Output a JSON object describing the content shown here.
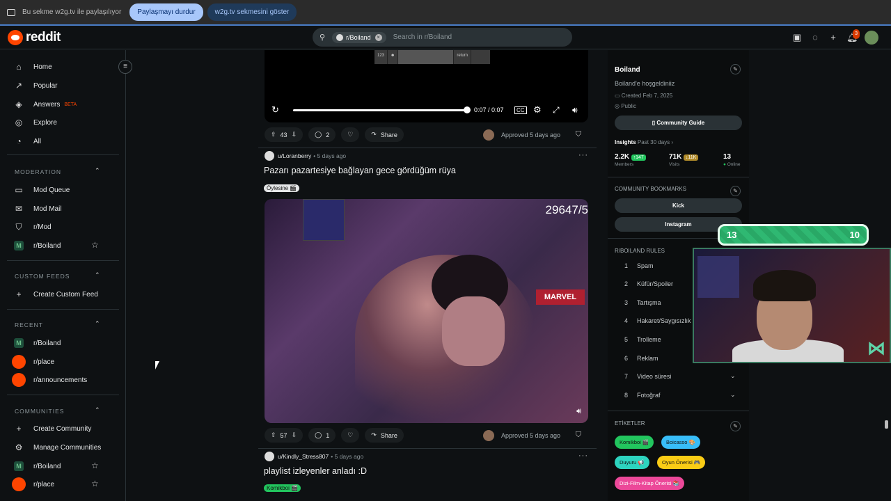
{
  "sharebar": {
    "text": "Bu sekme w2g.tv ile paylaşılıyor",
    "stop_label": "Paylaşmayı durdur",
    "show_label": "w2g.tv sekmesini göster"
  },
  "header": {
    "logo": "reddit",
    "search_chip": "r/Boiland",
    "search_placeholder": "Search in r/Boiland",
    "notif_count": "3"
  },
  "sidebar": {
    "nav": [
      {
        "label": "Home"
      },
      {
        "label": "Popular"
      },
      {
        "label": "Answers",
        "badge": "BETA"
      },
      {
        "label": "Explore"
      },
      {
        "label": "All"
      }
    ],
    "moderation": {
      "title": "MODERATION",
      "items": [
        "Mod Queue",
        "Mod Mail",
        "r/Mod",
        "r/Boiland"
      ]
    },
    "custom_feeds": {
      "title": "CUSTOM FEEDS",
      "items": [
        "Create Custom Feed"
      ]
    },
    "recent": {
      "title": "RECENT",
      "items": [
        "r/Boiland",
        "r/place",
        "r/announcements"
      ]
    },
    "communities": {
      "title": "COMMUNITIES",
      "items": [
        "Create Community",
        "Manage Communities",
        "r/Boiland",
        "r/place"
      ]
    }
  },
  "feed": {
    "video1": {
      "keys": [
        "123",
        "",
        "return"
      ],
      "time": "0:07 / 0:07",
      "progress": 1.0
    },
    "post1_actions": {
      "votes": "43",
      "comments": "2",
      "share": "Share",
      "approved": "Approved 5 days ago"
    },
    "post2": {
      "user": "u/Loranberry",
      "time": "• 5 days ago",
      "title": "Pazarı pazartesiye bağlayan gece gördüğüm rüya",
      "flair": "Öylesine 🎬",
      "score_overlay": "29647/5",
      "actions": {
        "votes": "57",
        "comments": "1",
        "share": "Share",
        "approved": "Approved 5 days ago"
      }
    },
    "post3": {
      "user": "u/Kindly_Stress807",
      "time": "• 5 days ago",
      "title": "playlist izleyenler anladı :D",
      "flair": "Komikboi 🎬"
    }
  },
  "right": {
    "name": "Boiland",
    "description": "Boiland'e hoşgeldiniiz",
    "created": "Created Feb 7, 2025",
    "visibility": "Public",
    "guide_btn": "Community Guide",
    "insights_label": "Insights",
    "insights_period": "Past 30 days",
    "stats": [
      {
        "value": "2.2K",
        "delta": "↑147",
        "label": "Members"
      },
      {
        "value": "71K",
        "delta": "↓11K",
        "label": "Visits"
      },
      {
        "value": "13",
        "label": "Online"
      }
    ],
    "bookmarks_title": "COMMUNITY BOOKMARKS",
    "bookmarks": [
      "Kick",
      "Instagram"
    ],
    "rules_title": "R/BOILAND RULES",
    "rules": [
      {
        "n": "1",
        "t": "Spam"
      },
      {
        "n": "2",
        "t": "Küfür/Spoiler"
      },
      {
        "n": "3",
        "t": "Tartışma"
      },
      {
        "n": "4",
        "t": "Hakaret/Saygısızlık"
      },
      {
        "n": "5",
        "t": "Trolleme"
      },
      {
        "n": "6",
        "t": "Reklam"
      },
      {
        "n": "7",
        "t": "Video süresi"
      },
      {
        "n": "8",
        "t": "Fotoğraf"
      }
    ],
    "tags_title": "ETİKETLER",
    "tags": [
      "Komikboi 🎬",
      "Boicasso 🎨",
      "Duyuru 📢",
      "Oyun Önerisi 🎮",
      "Dizi-Film-Kitap Önerisi 📚"
    ]
  },
  "overlay": {
    "left_score": "13",
    "right_score": "10"
  },
  "colors": {
    "reddit": "#ff4500",
    "accent_green": "#2fb872",
    "tag1": "#22c55e",
    "tag2": "#38bdf8",
    "tag3": "#2dd4bf",
    "tag4": "#facc15",
    "tag5": "#ec4899"
  }
}
